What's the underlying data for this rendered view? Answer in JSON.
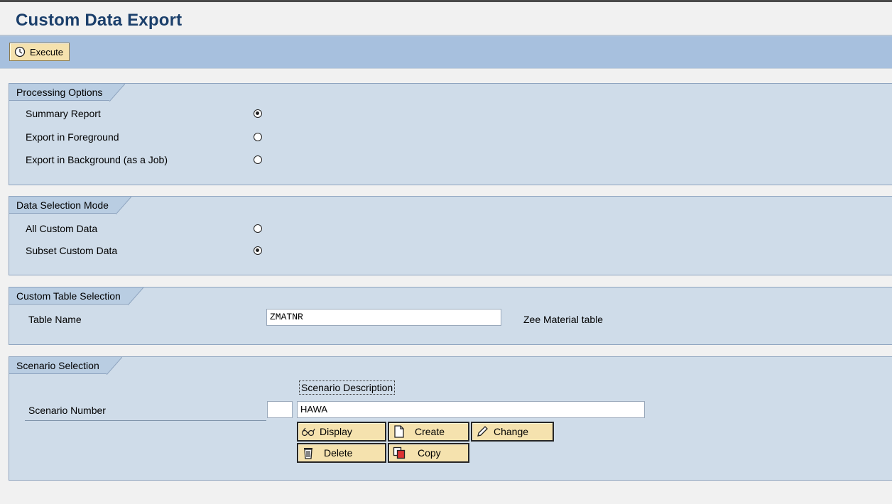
{
  "page": {
    "title": "Custom Data Export"
  },
  "toolbar": {
    "execute_label": "Execute"
  },
  "processing_options": {
    "heading": "Processing Options",
    "options": [
      {
        "label": "Summary Report",
        "selected": true
      },
      {
        "label": "Export in Foreground",
        "selected": false
      },
      {
        "label": "Export in Background (as a Job)",
        "selected": false
      }
    ]
  },
  "data_selection_mode": {
    "heading": "Data Selection Mode",
    "options": [
      {
        "label": "All Custom Data",
        "selected": false
      },
      {
        "label": "Subset Custom Data",
        "selected": true
      }
    ]
  },
  "custom_table_selection": {
    "heading": "Custom Table Selection",
    "table_name_label": "Table Name",
    "table_name_value": "ZMATNR",
    "table_description": "Zee Material table"
  },
  "scenario_selection": {
    "heading": "Scenario Selection",
    "description_header": "Scenario Description",
    "scenario_number_label": "Scenario Number",
    "scenario_number_value": "",
    "scenario_description_value": "HAWA",
    "buttons": {
      "display": "Display",
      "create": "Create",
      "change": "Change",
      "delete": "Delete",
      "copy": "Copy"
    }
  },
  "colors": {
    "title_text": "#1b3f6b",
    "toolbar_bg": "#a7c0de",
    "group_bg": "#cfdce9",
    "button_bg": "#f5e2ae"
  }
}
